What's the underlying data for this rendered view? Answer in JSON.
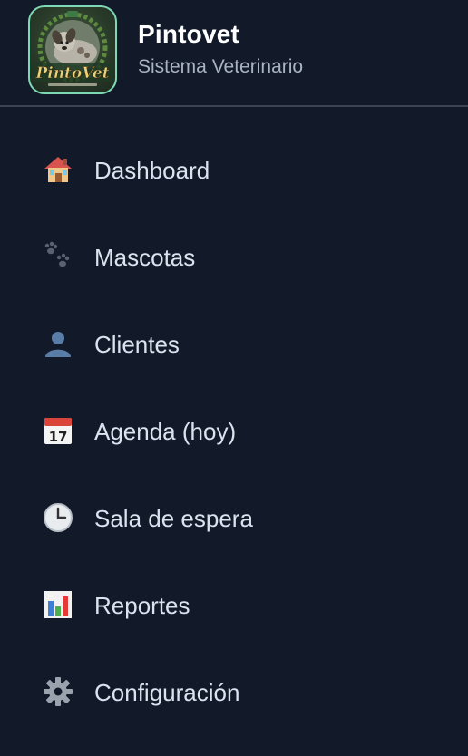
{
  "brand": {
    "name": "Pintovet",
    "subtitle": "Sistema Veterinario",
    "logo_text": "PintoVet"
  },
  "nav": {
    "items": [
      {
        "label": "Dashboard",
        "icon": "house-icon"
      },
      {
        "label": "Mascotas",
        "icon": "paw-prints-icon"
      },
      {
        "label": "Clientes",
        "icon": "person-silhouette-icon"
      },
      {
        "label": "Agenda (hoy)",
        "icon": "calendar-icon"
      },
      {
        "label": "Sala de espera",
        "icon": "clock-icon"
      },
      {
        "label": "Reportes",
        "icon": "bar-chart-icon"
      },
      {
        "label": "Configuración",
        "icon": "gear-icon"
      }
    ]
  },
  "colors": {
    "background": "#121a2a",
    "divider": "#3a4455",
    "logo_border": "#7fd8b4",
    "title": "#ffffff",
    "subtitle": "#a9b3c2",
    "nav_text": "#dbe3ee"
  }
}
